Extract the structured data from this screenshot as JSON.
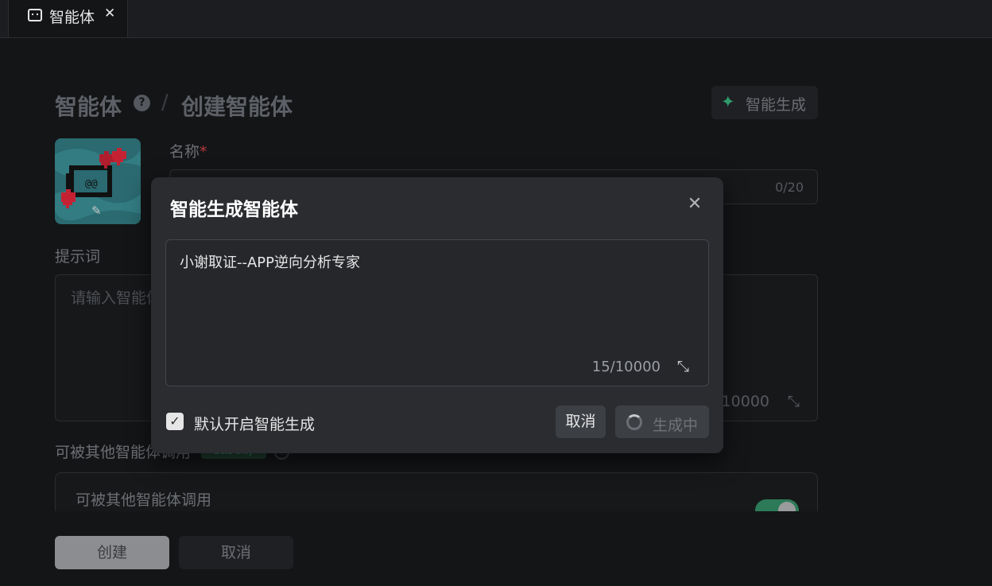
{
  "tab": {
    "label": "智能体",
    "close": "✕"
  },
  "breadcrumb": {
    "root": "智能体",
    "help": "?",
    "sep": "/",
    "current": "创建智能体"
  },
  "smart_gen_button": {
    "label": "智能生成",
    "icon": "sparkle-icon"
  },
  "form": {
    "name_label": "名称",
    "required_mark": "*",
    "name_counter": "0/20",
    "prompt_label": "提示词",
    "prompt_placeholder": "请输入智能体",
    "prompt_counter": "/10000",
    "callable_title": "可被其他智能体调用",
    "beta_badge": "Beta Only",
    "callable_card_label": "可被其他智能体调用",
    "callable_enabled": true
  },
  "footer": {
    "create": "创建",
    "cancel": "取消"
  },
  "modal": {
    "title": "智能生成智能体",
    "close": "✕",
    "input_value": "小谢取证--APP逆向分析专家",
    "counter": "15/10000",
    "checkbox_checked": true,
    "checkbox_label": "默认开启智能生成",
    "cancel": "取消",
    "generating": "生成中"
  },
  "colors": {
    "accent_green": "#2f9a6c",
    "background": "#141517",
    "modal_bg": "#2a2c30"
  }
}
